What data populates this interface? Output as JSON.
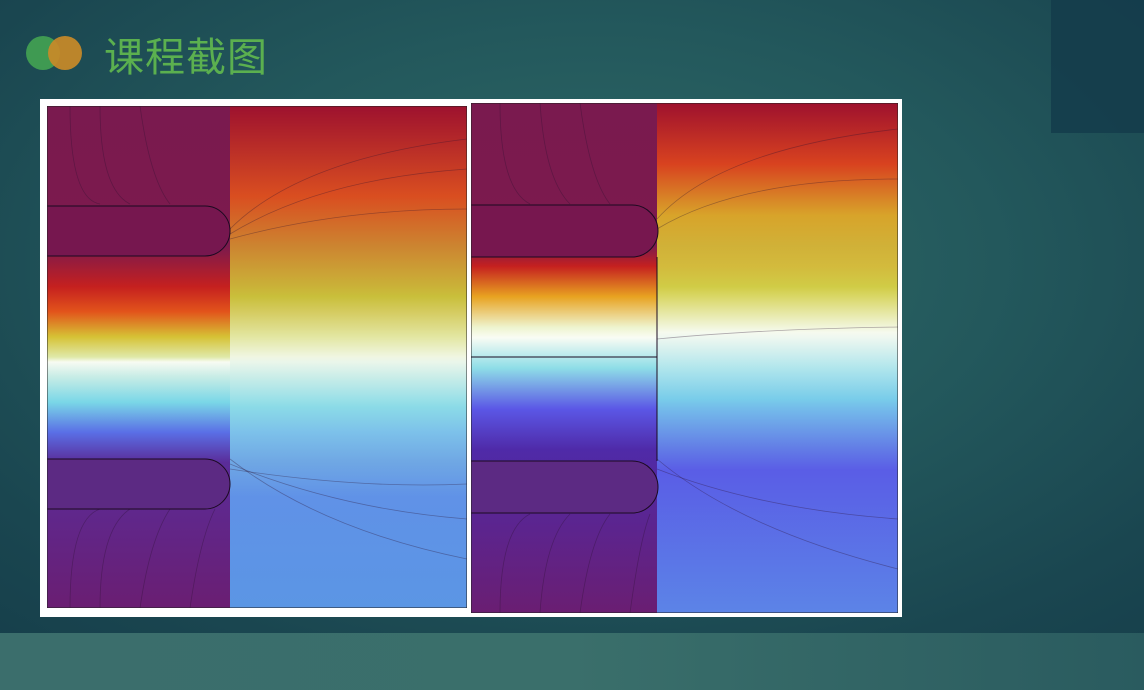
{
  "slide": {
    "title": "课程截图"
  },
  "colors": {
    "title": "#5bb04f",
    "logo_left": "#3f9a52",
    "logo_right": "#c98a28",
    "background": "#23585c"
  },
  "figure": {
    "description_icon": "field-plot-icon",
    "panels": [
      "left-field-plot",
      "right-field-plot"
    ]
  }
}
